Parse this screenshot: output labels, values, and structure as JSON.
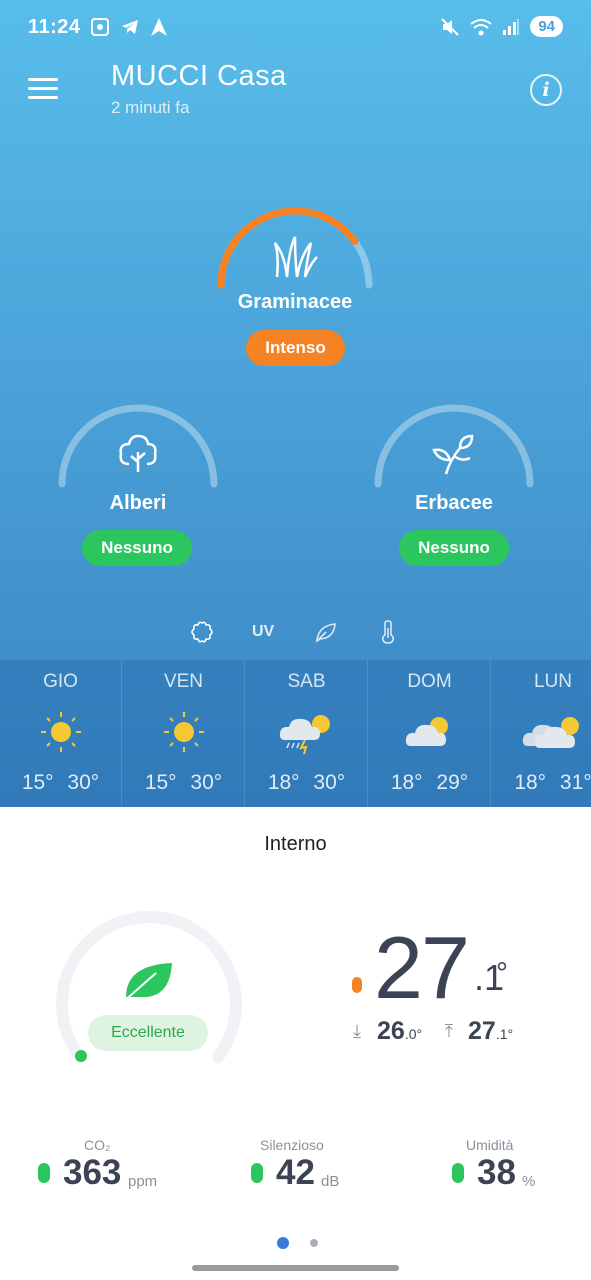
{
  "status_bar": {
    "time": "11:24",
    "battery": "94",
    "icons": [
      "screenshot-icon",
      "telegram-icon",
      "navigation-icon",
      "mute-icon",
      "wifi-icon",
      "signal-icon"
    ]
  },
  "header": {
    "title": "MUCCI Casa",
    "subtitle": "2 minuti fa"
  },
  "pollen": {
    "main": {
      "label": "Graminacee",
      "level": "Intenso",
      "level_color": "#f58223",
      "fraction": 0.8
    },
    "left": {
      "label": "Alberi",
      "level": "Nessuno",
      "level_color": "#2cc65e",
      "fraction": 0
    },
    "right": {
      "label": "Erbacee",
      "level": "Nessuno",
      "level_color": "#2cc65e",
      "fraction": 0
    }
  },
  "tabs": {
    "uv": "UV"
  },
  "forecast": [
    {
      "day": "GIO",
      "min": "15°",
      "max": "30°",
      "icon": "sun-icon"
    },
    {
      "day": "VEN",
      "min": "15°",
      "max": "30°",
      "icon": "sun-icon"
    },
    {
      "day": "SAB",
      "min": "18°",
      "max": "30°",
      "icon": "storm-icon"
    },
    {
      "day": "DOM",
      "min": "18°",
      "max": "29°",
      "icon": "partly-cloudy-icon"
    },
    {
      "day": "LUN",
      "min": "18°",
      "max": "31°",
      "icon": "partly-cloudy-icon"
    }
  ],
  "indoor": {
    "title": "Interno",
    "air_quality": "Eccellente",
    "temp_int": "27",
    "temp_dec": ".1",
    "temp_deg": "°",
    "min_int": "26",
    "min_dec": ".0",
    "max_int": "27",
    "max_dec": ".1",
    "deg": "°",
    "metrics": [
      {
        "label": "CO₂",
        "value": "363",
        "unit": "ppm"
      },
      {
        "label": "Silenzioso",
        "value": "42",
        "unit": "dB"
      },
      {
        "label": "Umidità",
        "value": "38",
        "unit": "%"
      }
    ]
  },
  "colors": {
    "accent": "#2cc65e",
    "warning": "#f58223",
    "pager_active": "#3a78d9"
  }
}
